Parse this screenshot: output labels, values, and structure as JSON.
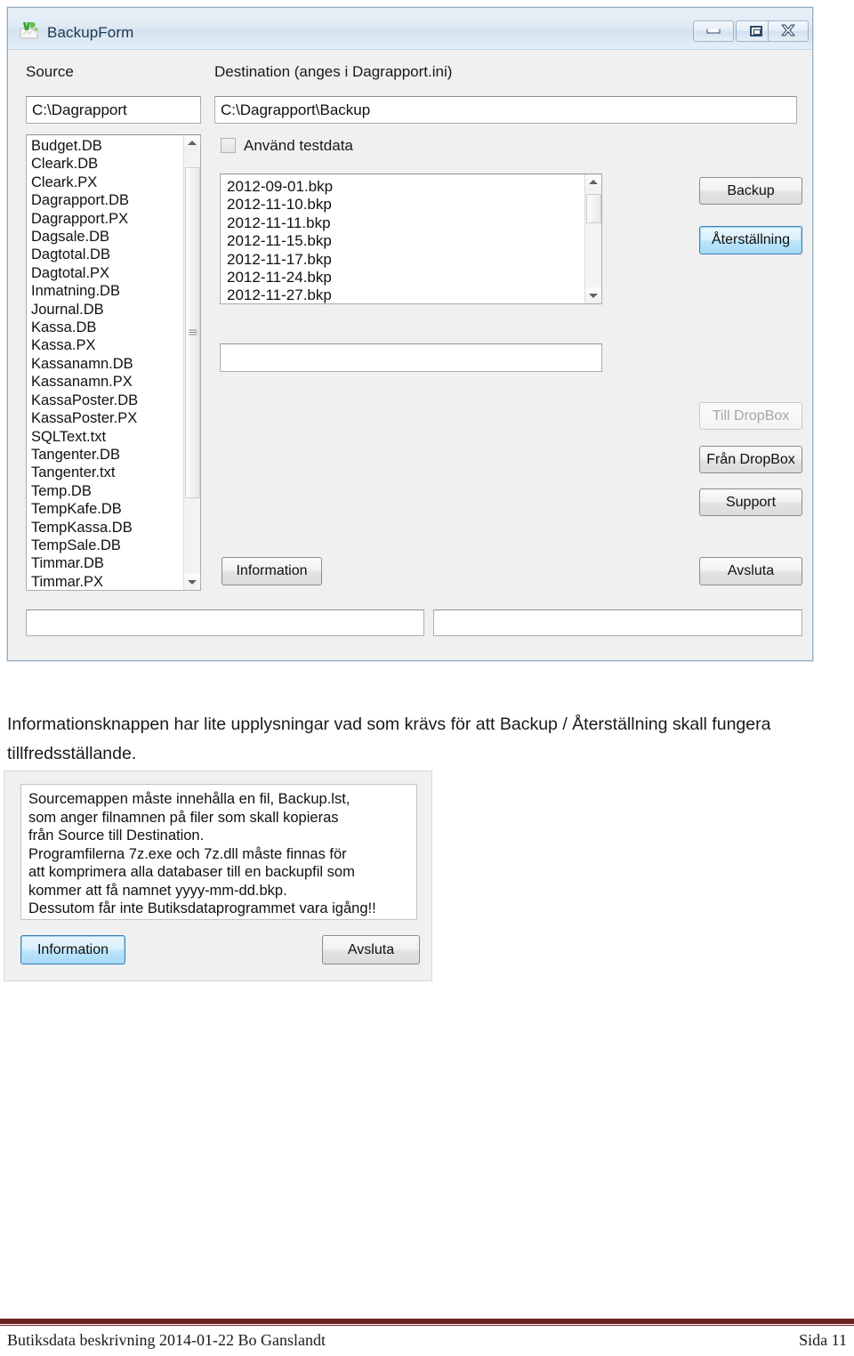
{
  "window": {
    "title": "BackupForm",
    "icon": "vb-form-icon",
    "controls": {
      "minimize": "minimize-icon",
      "maximize": "maximize-icon",
      "close": "close-icon"
    }
  },
  "form": {
    "source_label": "Source",
    "destination_label": "Destination (anges i Dagrapport.ini)",
    "source_path": "C:\\Dagrapport",
    "destination_path": "C:\\Dagrapport\\Backup",
    "source_placeholder": "",
    "destination_placeholder": "",
    "checkbox": {
      "label": "Använd testdata",
      "checked": false
    },
    "source_files": [
      "Budget.DB",
      "Cleark.DB",
      "Cleark.PX",
      "Dagrapport.DB",
      "Dagrapport.PX",
      "Dagsale.DB",
      "Dagtotal.DB",
      "Dagtotal.PX",
      "Inmatning.DB",
      "Journal.DB",
      "Kassa.DB",
      "Kassa.PX",
      "Kassanamn.DB",
      "Kassanamn.PX",
      "KassaPoster.DB",
      "KassaPoster.PX",
      "SQLText.txt",
      "Tangenter.DB",
      "Tangenter.txt",
      "Temp.DB",
      "TempKafe.DB",
      "TempKassa.DB",
      "TempSale.DB",
      "Timmar.DB",
      "Timmar.PX"
    ],
    "backup_files": [
      "2012-09-01.bkp",
      "2012-11-10.bkp",
      "2012-11-11.bkp",
      "2012-11-15.bkp",
      "2012-11-17.bkp",
      "2012-11-24.bkp",
      "2012-11-27.bkp"
    ],
    "selected_backup_field": "",
    "status_left": "",
    "status_right": "",
    "buttons": {
      "backup": "Backup",
      "aterstallning": "Återställning",
      "till_dropbox": "Till DropBox",
      "fran_dropbox": "Från DropBox",
      "support": "Support",
      "avsluta": "Avsluta",
      "information": "Information"
    }
  },
  "paragraph": "Informationsknappen har lite upplysningar vad som krävs för att Backup / Återställning skall fungera tillfredsställande.",
  "info_dialog": {
    "lines": [
      "Sourcemappen måste innehålla en fil, Backup.lst,",
      "som anger filnamnen på filer som skall kopieras",
      "från Source till Destination.",
      "Programfilerna 7z.exe och 7z.dll måste finnas för",
      "att komprimera alla databaser till en backupfil som",
      "kommer att få namnet yyyy-mm-dd.bkp.",
      "Dessutom får inte Butiksdataprogrammet vara igång!!"
    ],
    "information_button": "Information",
    "avsluta_button": "Avsluta"
  },
  "footer": {
    "left": "Butiksdata beskrivning 2014-01-22 Bo Ganslandt",
    "right": "Sida 11",
    "rule_color": "#6E2121"
  }
}
